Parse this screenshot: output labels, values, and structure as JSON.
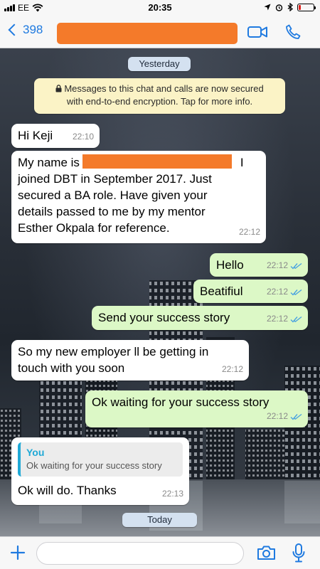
{
  "status_bar": {
    "carrier": "EE",
    "time": "20:35",
    "battery_level": 0.15
  },
  "header": {
    "back_count": "398",
    "contact_name_redacted": true
  },
  "icons": {
    "video_call": "video-camera-icon",
    "voice_call": "phone-icon",
    "attach": "plus-icon",
    "camera": "camera-icon",
    "voice_message": "microphone-icon"
  },
  "colors": {
    "accent": "#1f7ae0",
    "incoming_bubble": "#ffffff",
    "outgoing_bubble": "#dcf8c6",
    "read_ticks": "#4aa3e0",
    "redaction": "#f47a2a"
  },
  "chat": {
    "date_yesterday": "Yesterday",
    "encryption_notice_line1": "Messages to this chat and calls are now secured",
    "encryption_notice_line2": "with end-to-end encryption. Tap for more info.",
    "date_today": "Today",
    "messages": [
      {
        "direction": "in",
        "text": "Hi Keji",
        "time": "22:10"
      },
      {
        "direction": "in",
        "line1_start": "My name is",
        "line1_end": "I",
        "lines": [
          "joined DBT in September 2017. Just",
          "secured a BA role. Have given your",
          "details passed to me by my mentor",
          "Esther Okpala for reference."
        ],
        "time": "22:12"
      },
      {
        "direction": "out",
        "text": "Hello",
        "time": "22:12"
      },
      {
        "direction": "out",
        "text": "Beatifiul",
        "time": "22:12"
      },
      {
        "direction": "out",
        "text": "Send your success story",
        "time": "22:12"
      },
      {
        "direction": "in",
        "lines": [
          "So my new employer ll be getting in",
          "touch with you soon"
        ],
        "time": "22:12"
      },
      {
        "direction": "out",
        "text": "Ok waiting for your success story",
        "time": "22:12"
      },
      {
        "direction": "in",
        "quote_author": "You",
        "quote_text": "Ok waiting for your success story",
        "text": "Ok will do. Thanks",
        "time": "22:13"
      }
    ]
  },
  "composer": {
    "value": "",
    "placeholder": ""
  }
}
